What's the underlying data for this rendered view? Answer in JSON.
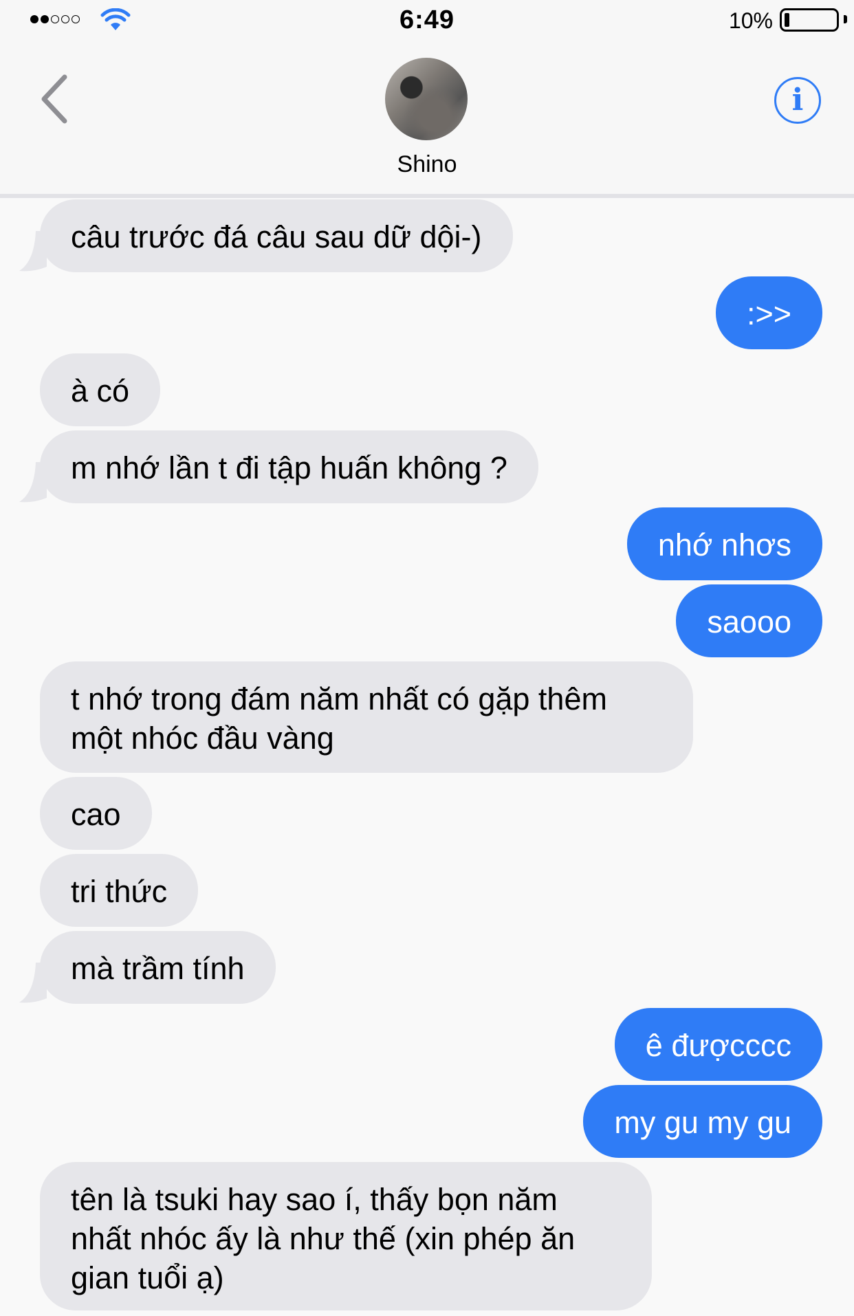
{
  "status_bar": {
    "time": "6:49",
    "battery_percent": "10%",
    "battery_level": 0.1,
    "signal_bars_filled": 2,
    "signal_bars_total": 5
  },
  "header": {
    "contact_name": "Shino",
    "info_label": "i"
  },
  "messages": [
    {
      "side": "in",
      "text": "câu trước đá câu sau dữ dội-)"
    },
    {
      "side": "out",
      "text": ":>>"
    },
    {
      "side": "in",
      "text": "à có"
    },
    {
      "side": "in",
      "text": "m nhớ lần t đi tập huấn không ?"
    },
    {
      "side": "out",
      "text": "nhớ nhơs"
    },
    {
      "side": "out",
      "text": "saooo"
    },
    {
      "side": "in",
      "text": "t nhớ trong đám năm nhất có gặp thêm một nhóc đầu vàng"
    },
    {
      "side": "in",
      "text": "cao"
    },
    {
      "side": "in",
      "text": "tri thức"
    },
    {
      "side": "in",
      "text": "mà trầm tính"
    },
    {
      "side": "out",
      "text": "ê đượcccc"
    },
    {
      "side": "out",
      "text": "my gu my gu"
    },
    {
      "side": "in",
      "text": "tên là tsuki hay sao í, thấy bọn năm nhất nhóc ấy là như thế (xin phép ăn gian tuổi ạ)"
    }
  ],
  "colors": {
    "outgoing": "#2f7cf6",
    "incoming": "#e6e6ea",
    "accent": "#2f7cf6"
  }
}
